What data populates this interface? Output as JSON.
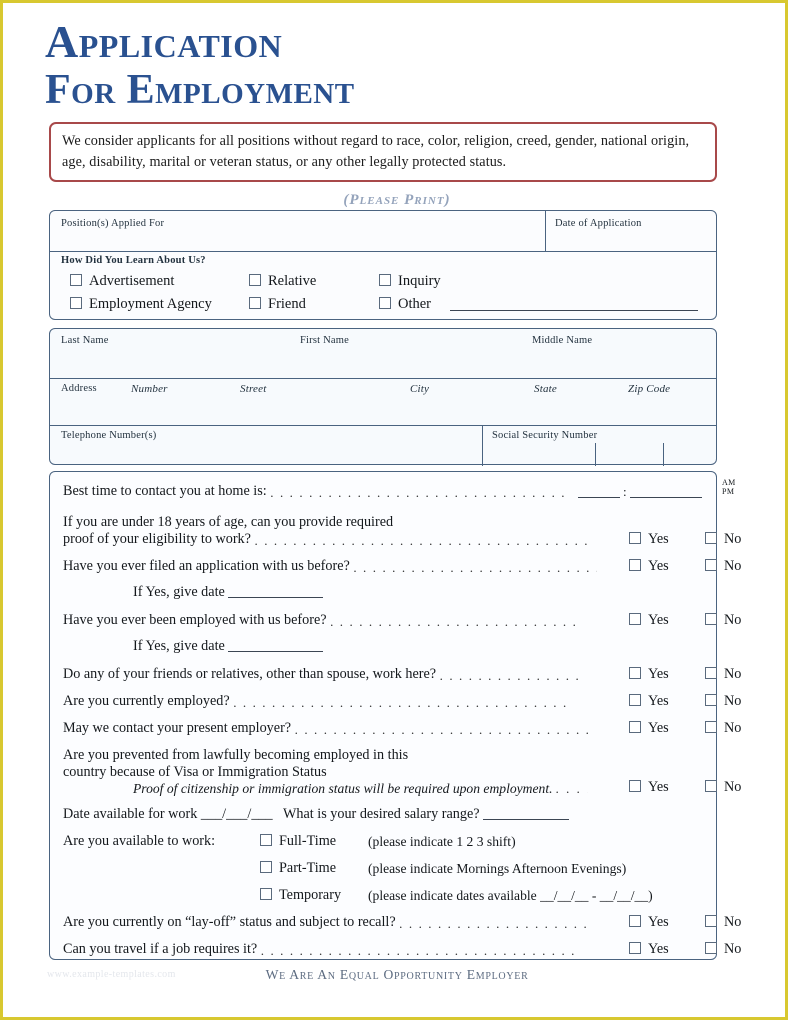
{
  "document": {
    "title_line1": "Application",
    "title_line2": "For Employment",
    "notice": "We consider applicants for all positions without regard to race, color, religion, creed, gender, national origin, age, disability, marital or veteran status, or any other legally protected status.",
    "please_print": "(Please Print)",
    "footer": "We Are An Equal Opportunity Employer",
    "watermark": "www.example-templates.com"
  },
  "colors": {
    "title_blue": "#2a5190",
    "notice_border": "#a8494a",
    "box_border": "#4a6380",
    "page_border": "#d8c830",
    "muted_blue": "#94a3bb"
  },
  "position_section": {
    "position_applied_for": "Position(s) Applied For",
    "date_of_application": "Date of Application",
    "how_did_you_learn": "How Did You Learn About Us?",
    "options": [
      "Advertisement",
      "Relative",
      "Inquiry",
      "Employment Agency",
      "Friend",
      "Other"
    ]
  },
  "identity_section": {
    "row1": [
      "Last Name",
      "First Name",
      "Middle Name"
    ],
    "row2": [
      "Address",
      "Number",
      "Street",
      "City",
      "State",
      "Zip Code"
    ],
    "row3": [
      "Telephone Number(s)",
      "Social Security Number"
    ]
  },
  "questions": {
    "best_time": "Best time to contact you at home is:",
    "am": "AM",
    "pm": "PM",
    "under18_line1": "If you are under 18 years of age, can you provide required",
    "under18_line2": "proof of your eligibility to work?",
    "filed_before": "Have you ever filed an application with us before?",
    "if_yes_give_date": "If Yes, give date",
    "employed_before": "Have you ever been employed with us before?",
    "friends_relatives": "Do any of your friends or relatives, other than spouse, work here?",
    "currently_employed": "Are you currently employed?",
    "contact_present_employer": "May we contact your present employer?",
    "visa_line1": "Are you prevented from lawfully becoming employed in this",
    "visa_line2": "country because of Visa or Immigration Status",
    "visa_italic": "Proof of citizenship or immigration status will be required upon employment.",
    "date_available": "Date available for work",
    "date_available_blank": "___/___/___",
    "salary_question": "What is your desired salary range?",
    "available_to_work": "Are you available to work:",
    "full_time": "Full-Time",
    "full_time_note": "(please indicate 1   2   3  shift)",
    "part_time": "Part-Time",
    "part_time_note": "(please indicate Mornings   Afternoon   Evenings)",
    "temporary": "Temporary",
    "temporary_note": "(please indicate dates available  __/__/__  -  __/__/__)",
    "layoff": "Are you currently on “lay-off” status and subject to recall?",
    "travel": "Can you travel if a job requires it?",
    "yes": "Yes",
    "no": "No"
  }
}
